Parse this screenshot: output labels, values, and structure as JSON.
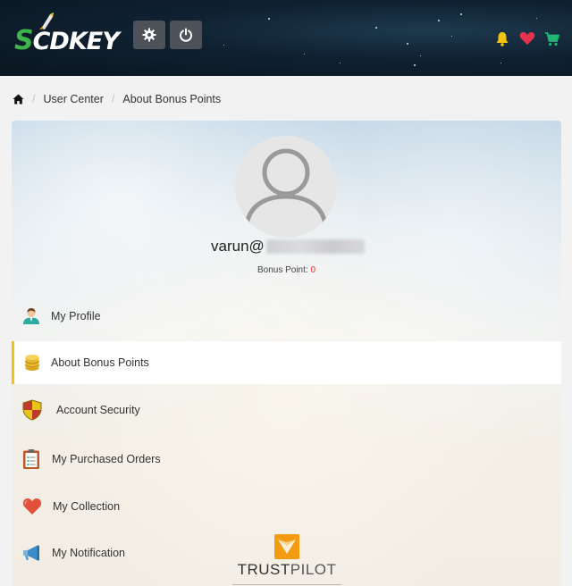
{
  "header": {
    "logo_text": "SCDKEY",
    "settings_icon": "gear-icon",
    "power_icon": "power-icon",
    "notification_icon": "bell-icon",
    "wishlist_icon": "heart-icon",
    "cart_icon": "cart-icon",
    "colors": {
      "bell": "#f1c40f",
      "heart": "#e6334d",
      "cart": "#1fb573"
    }
  },
  "breadcrumb": {
    "home_icon": "home-icon",
    "items": [
      "User Center",
      "About Bonus Points"
    ]
  },
  "profile": {
    "username_visible": "varun@",
    "bonus_label": "Bonus Point:",
    "bonus_value": "0"
  },
  "menu": {
    "items": [
      {
        "label": "My Profile",
        "icon": "user-icon",
        "active": false
      },
      {
        "label": "About Bonus Points",
        "icon": "coins-icon",
        "active": true
      },
      {
        "label": "Account Security",
        "icon": "shield-icon",
        "active": false
      },
      {
        "label": "My Purchased Orders",
        "icon": "clipboard-icon",
        "active": false
      },
      {
        "label": "My Collection",
        "icon": "heart-icon",
        "active": false
      },
      {
        "label": "My Notification",
        "icon": "megaphone-icon",
        "active": false
      }
    ]
  },
  "trustpilot": {
    "brand_main": "TRUST",
    "brand_light": "PILOT",
    "color": "#f39c12"
  }
}
